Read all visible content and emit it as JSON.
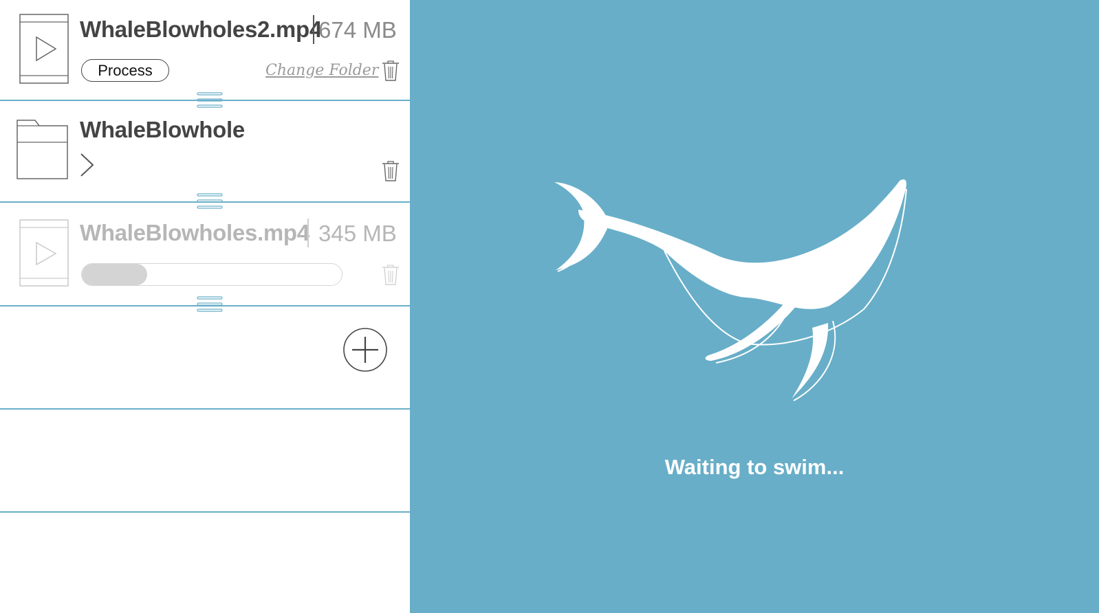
{
  "queue": {
    "items": [
      {
        "kind": "video",
        "name": "WhaleBlowholes2.mp4",
        "size": "674 MB",
        "process_label": "Process",
        "change_folder_label": "Change Folder",
        "icon": "video-file-icon"
      },
      {
        "kind": "folder",
        "name": "WhaleBlowhole",
        "icon": "folder-icon"
      },
      {
        "kind": "video",
        "name": "WhaleBlowholes.mp4",
        "size": "345 MB",
        "progress": 0.25,
        "icon": "video-file-icon"
      }
    ],
    "add_icon": "plus-circle-icon"
  },
  "preview": {
    "status": "Waiting to swim...",
    "illustration": "whale-icon"
  },
  "colors": {
    "accent": "#68aec8",
    "text_dark": "#444444",
    "text_muted": "#8a8a8a",
    "text_disabled": "#b6b6b6"
  }
}
